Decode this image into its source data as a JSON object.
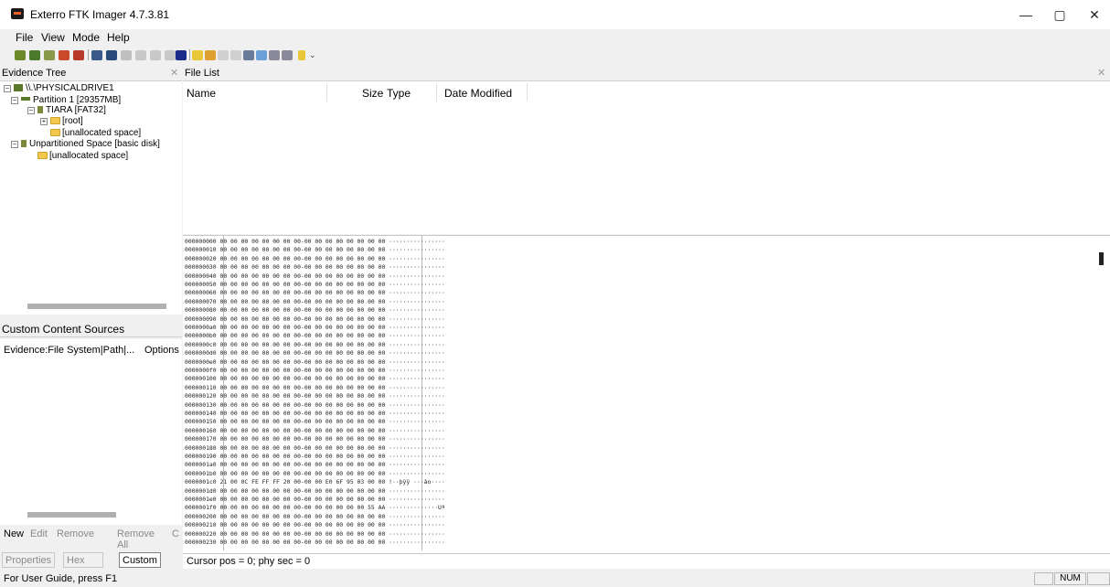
{
  "window": {
    "title": "Exterro FTK Imager 4.7.3.81",
    "minimize": "—",
    "maximize": "▢",
    "close": "✕"
  },
  "menu": [
    "File",
    "View",
    "Mode",
    "Help"
  ],
  "evidence_tree": {
    "header": "Evidence Tree",
    "nodes": [
      "\\\\.\\PHYSICALDRIVE1",
      "Partition 1 [29357MB]",
      "TIARA [FAT32]",
      "[root]",
      "[unallocated space]",
      "Unpartitioned Space [basic disk]",
      "[unallocated space]"
    ]
  },
  "file_list": {
    "header": "File List",
    "columns": [
      "Name",
      "Size",
      "Type",
      "Date Modified"
    ]
  },
  "custom_content": {
    "header": "Custom Content Sources",
    "col1": "Evidence:File System|Path|...",
    "col2": "Options"
  },
  "buttons": [
    "New",
    "Edit",
    "Remove",
    "Remove All",
    "C"
  ],
  "tabs": [
    "Properties",
    "Hex Value...",
    "Custom C..."
  ],
  "cursor_text": "Cursor pos = 0; phy sec = 0",
  "status": {
    "text": "For User Guide, press F1",
    "num": "NUM"
  },
  "hex": {
    "offsets": [
      "000000000",
      "000000010",
      "000000020",
      "000000030",
      "000000040",
      "000000050",
      "000000060",
      "000000070",
      "000000080",
      "000000090",
      "0000000a0",
      "0000000b0",
      "0000000c0",
      "0000000d0",
      "0000000e0",
      "0000000f0",
      "000000100",
      "000000110",
      "000000120",
      "000000130",
      "000000140",
      "000000150",
      "000000160",
      "000000170",
      "000000180",
      "000000190",
      "0000001a0",
      "0000001b0",
      "0000001c0",
      "0000001d0",
      "0000001e0",
      "0000001f0",
      "000000200",
      "000000210",
      "000000220",
      "000000230"
    ],
    "zero_bytes": "00 00 00 00 00 00 00 00-00 00 00 00 00 00 00 00",
    "zero_ascii": "················",
    "special": {
      "0000001c0": {
        "bytes": "21 00 0C FE FF FF 20 00-00 00 E0 6F 95 03 00 00",
        "ascii": "!··þÿÿ ···ào····"
      },
      "0000001f0": {
        "bytes": "00 00 00 00 00 00 00 00-00 00 00 00 00 00 55 AA",
        "ascii": "··············Uª"
      }
    }
  }
}
